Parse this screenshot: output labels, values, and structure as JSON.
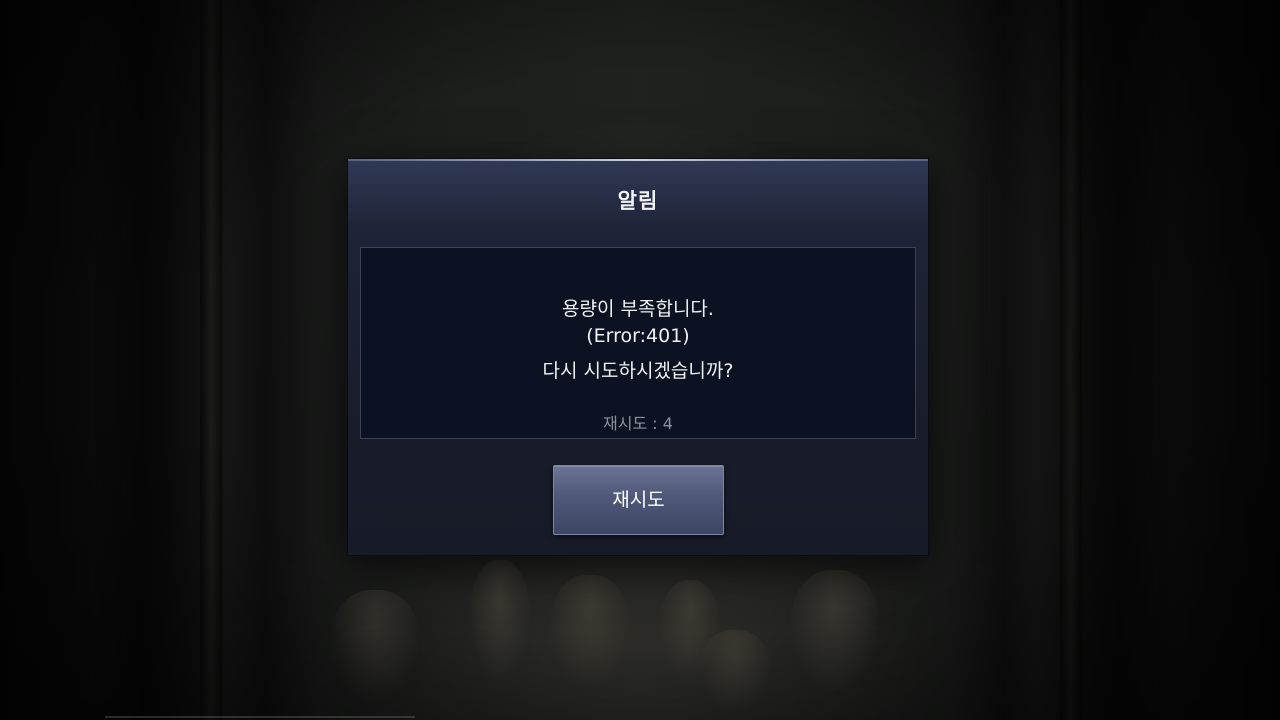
{
  "dialog": {
    "title": "알림",
    "message_line1": "용량이 부족합니다.",
    "message_line2": "(Error:401)",
    "message_line3": "다시 시도하시겠습니까?",
    "retry_count_label": "재시도",
    "retry_count_separator": " : ",
    "retry_count_value": "4",
    "retry_button_label": "재시도"
  },
  "colors": {
    "dialog_header": "#303956",
    "dialog_body": "#0d1222",
    "button": "#4f5878"
  }
}
